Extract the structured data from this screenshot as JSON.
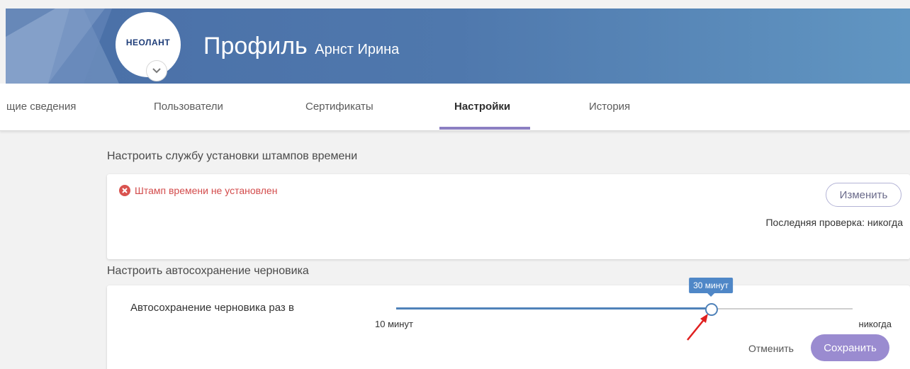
{
  "header": {
    "logo_text": "НЕОЛАНТ",
    "title": "Профиль",
    "subtitle": "Арнст Ирина"
  },
  "tabs": [
    {
      "label": "щие сведения",
      "active": false
    },
    {
      "label": "Пользователи",
      "active": false
    },
    {
      "label": "Сертификаты",
      "active": false
    },
    {
      "label": "Настройки",
      "active": true
    },
    {
      "label": "История",
      "active": false
    }
  ],
  "timestamp_section": {
    "title": "Настроить службу установки штампов времени",
    "status_text": "Штамп времени не установлен",
    "change_button": "Изменить",
    "last_check": "Последняя проверка: никогда"
  },
  "autosave_section": {
    "title": "Настроить автосохранение черновика",
    "label": "Автосохранение черновика раз в",
    "slider": {
      "value_label": "30 минут",
      "min_label": "10 минут",
      "max_label": "никогда",
      "position_fraction": 0.69
    },
    "cancel_button": "Отменить",
    "save_button": "Сохранить"
  },
  "colors": {
    "banner": "#4f78ad",
    "accent": "#9a8bd0",
    "error": "#d34c4c",
    "slider": "#4f82b9"
  }
}
